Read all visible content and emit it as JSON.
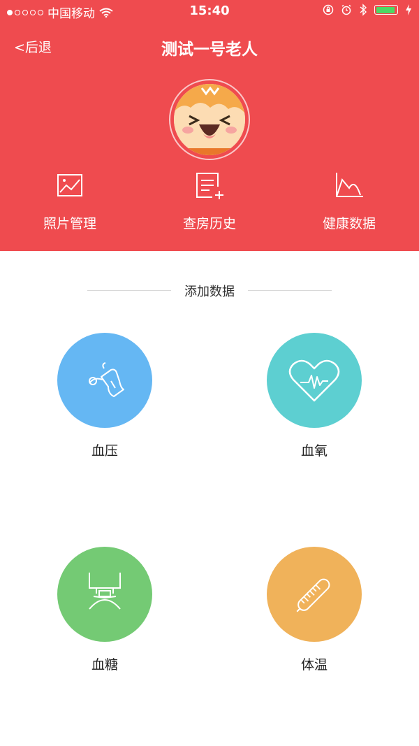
{
  "status_bar": {
    "carrier": "中国移动",
    "time": "15:40",
    "signal_dots_filled": 1,
    "signal_dots_total": 5,
    "battery_level_percent": 90
  },
  "nav": {
    "back_label": "<后退",
    "title": "测试一号老人"
  },
  "quick_actions": [
    {
      "label": "照片管理",
      "icon": "photo-icon"
    },
    {
      "label": "查房历史",
      "icon": "list-add-icon"
    },
    {
      "label": "健康数据",
      "icon": "chart-icon"
    }
  ],
  "section": {
    "title": "添加数据"
  },
  "measurements": [
    {
      "label": "血压",
      "icon": "blood-pressure-cuff-icon",
      "color": "#65b7f3"
    },
    {
      "label": "血氧",
      "icon": "heart-pulse-icon",
      "color": "#5dcfd1"
    },
    {
      "label": "血糖",
      "icon": "glucose-meter-icon",
      "color": "#74ca74"
    },
    {
      "label": "体温",
      "icon": "thermometer-icon",
      "color": "#f0b25a"
    }
  ],
  "colors": {
    "header": "#ef4b4f",
    "battery": "#4cd964"
  }
}
